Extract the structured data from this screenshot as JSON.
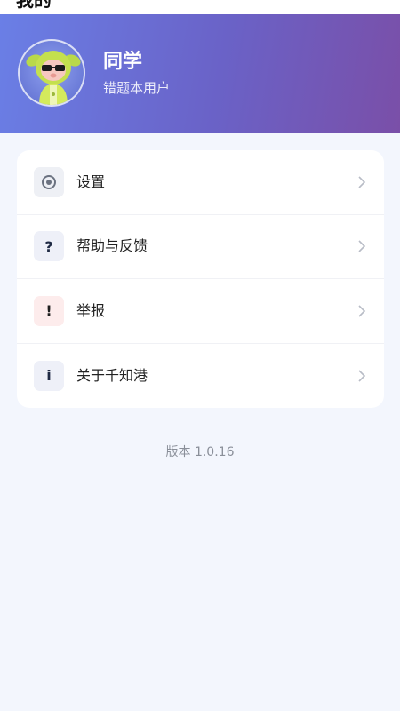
{
  "nav": {
    "title": "我的"
  },
  "profile": {
    "name": "同学",
    "subtitle": "错题本用户"
  },
  "menu": {
    "items": [
      {
        "icon": "settings-icon",
        "glyph": "",
        "label": "设置"
      },
      {
        "icon": "question-icon",
        "glyph": "?",
        "label": "帮助与反馈"
      },
      {
        "icon": "exclamation-icon",
        "glyph": "!",
        "label": "举报"
      },
      {
        "icon": "info-icon",
        "glyph": "i",
        "label": "关于千知港"
      }
    ]
  },
  "footer": {
    "version": "版本 1.0.16"
  },
  "colors": {
    "header_gradient_start": "#6a7fe6",
    "header_gradient_end": "#7a4fa8",
    "page_background": "#f3f6fd",
    "card_background": "#ffffff",
    "report_icon_bg": "#fdecec"
  }
}
